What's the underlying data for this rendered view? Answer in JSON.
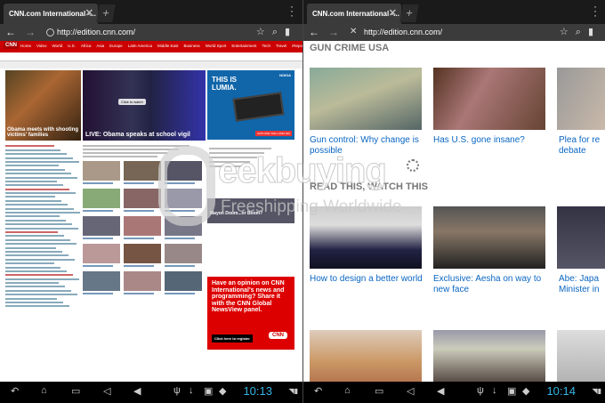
{
  "left": {
    "tab": {
      "title": "CNN.com International -..."
    },
    "url": "http://edition.cnn.com/",
    "time": "10:13",
    "cnn": {
      "logo": "CNN",
      "nav": [
        "Home",
        "Video",
        "World",
        "U.S.",
        "Africa",
        "Asia",
        "Europe",
        "Latin America",
        "Middle East",
        "Business",
        "World Sport",
        "Entertainment",
        "Tech",
        "Travel",
        "iReport"
      ],
      "hero_left_caption": "Obama meets with shooting victims' families",
      "hero_main_caption": "LIVE: Obama speaks at school vigil",
      "hero_main_control": "Click to watch",
      "nokia_ad": {
        "line1": "THIS IS",
        "line2": "LUMIA.",
        "brand": "NOKIA",
        "cta": "EXPLORE THE LUMIA 920"
      },
      "mayon": "Mayon Doom...or Boom?",
      "cnn_ad": {
        "headline": "Have an opinion on CNN International's news and programming? Share it with the CNN Global NewsView panel.",
        "button": "Click here to register",
        "logo": "CNN"
      }
    }
  },
  "right": {
    "tab": {
      "title": "CNN.com International -..."
    },
    "url": "http://edition.cnn.com/",
    "time": "10:14",
    "sections": {
      "gun_crime": "GUN CRIME USA",
      "read_watch": "READ THIS, WATCH THIS"
    },
    "cards_row1": [
      {
        "title": "Gun control: Why change is possible"
      },
      {
        "title": "Has U.S. gone insane?"
      },
      {
        "title": "Plea for re debate"
      }
    ],
    "cards_row2": [
      {
        "title": "How to design a better world"
      },
      {
        "title": "Exclusive: Aesha on way to new face"
      },
      {
        "title": "Abe: Japa Minister in"
      }
    ]
  },
  "watermark": {
    "main": "eekbuying",
    "sub": "Freeshipping Worldwide"
  },
  "colors": {
    "cnn_red": "#cc0000",
    "link_blue": "#0a66c2",
    "clock_blue": "#33b5e5"
  }
}
